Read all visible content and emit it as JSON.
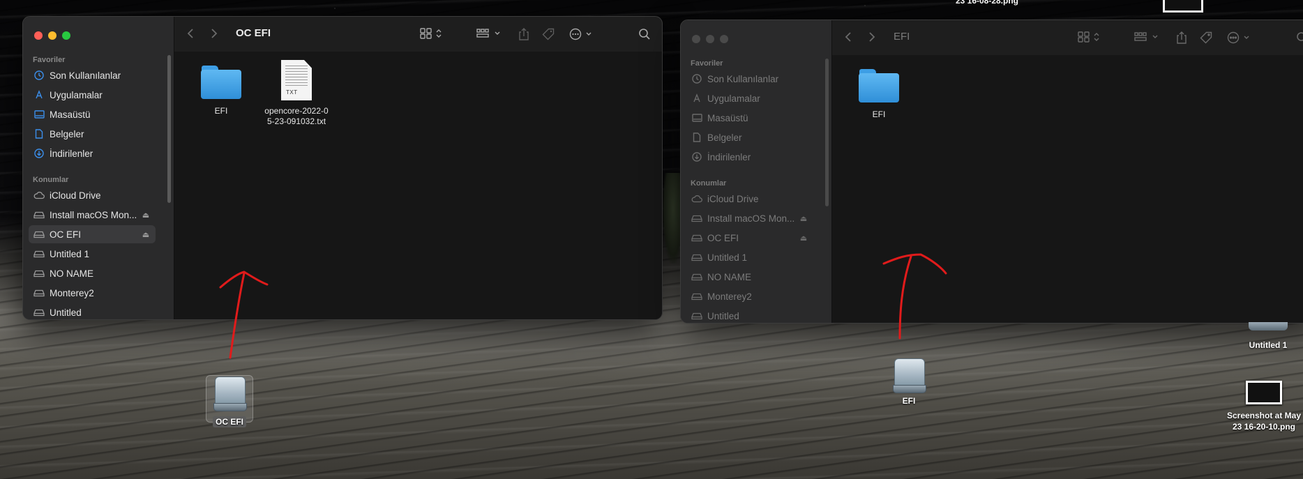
{
  "colors": {
    "close": "#ff5f57",
    "minimize": "#febc2e",
    "zoom": "#28c840",
    "accent": "#3b8eea",
    "annotation": "#e01b1b"
  },
  "left_window": {
    "title": "OC EFI",
    "sidebar": {
      "favorites_title": "Favoriler",
      "favorites": [
        {
          "label": "Son Kullanılanlar",
          "icon": "clock-icon"
        },
        {
          "label": "Uygulamalar",
          "icon": "apps-icon"
        },
        {
          "label": "Masaüstü",
          "icon": "desktop-icon"
        },
        {
          "label": "Belgeler",
          "icon": "document-icon"
        },
        {
          "label": "İndirilenler",
          "icon": "download-icon"
        }
      ],
      "locations_title": "Konumlar",
      "locations": [
        {
          "label": "iCloud Drive",
          "icon": "cloud-icon"
        },
        {
          "label": "Install macOS Mon...",
          "icon": "drive-icon",
          "eject": true
        },
        {
          "label": "OC EFI",
          "icon": "drive-icon",
          "eject": true,
          "selected": true
        },
        {
          "label": "Untitled 1",
          "icon": "drive-icon"
        },
        {
          "label": "NO NAME",
          "icon": "drive-icon"
        },
        {
          "label": "Monterey2",
          "icon": "drive-icon"
        },
        {
          "label": "Untitled",
          "icon": "drive-icon"
        }
      ]
    },
    "files": [
      {
        "name": "EFI",
        "type": "folder"
      },
      {
        "name_line1": "opencore-2022-0",
        "name_line2": "5-23-091032.txt",
        "type": "txt",
        "ext": "TXT"
      }
    ]
  },
  "right_window": {
    "title": "EFI",
    "sidebar": {
      "favorites_title": "Favoriler",
      "favorites": [
        {
          "label": "Son Kullanılanlar"
        },
        {
          "label": "Uygulamalar"
        },
        {
          "label": "Masaüstü"
        },
        {
          "label": "Belgeler"
        },
        {
          "label": "İndirilenler"
        }
      ],
      "locations_title": "Konumlar",
      "locations": [
        {
          "label": "iCloud Drive"
        },
        {
          "label": "Install macOS Mon...",
          "eject": true
        },
        {
          "label": "OC EFI",
          "eject": true
        },
        {
          "label": "Untitled 1"
        },
        {
          "label": "NO NAME"
        },
        {
          "label": "Monterey2"
        },
        {
          "label": "Untitled"
        }
      ]
    },
    "files": [
      {
        "name": "EFI",
        "type": "folder"
      }
    ]
  },
  "desktop": {
    "icons": {
      "oc_efi": "OC EFI",
      "efi": "EFI",
      "untitled1": "Untitled 1",
      "screenshot_line1": "Screenshot at May",
      "screenshot_line2": "23 16-20-10.png",
      "top_cut_label": "23 16-08-28.png"
    }
  }
}
